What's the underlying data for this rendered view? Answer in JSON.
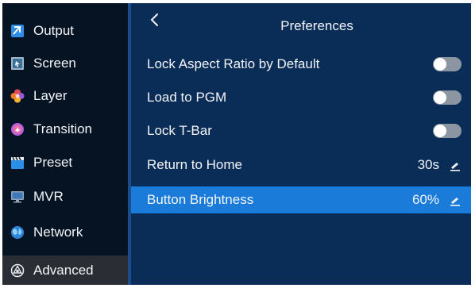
{
  "sidebar": {
    "items": [
      {
        "label": "Output",
        "icon": "output-icon"
      },
      {
        "label": "Screen",
        "icon": "screen-icon"
      },
      {
        "label": "Layer",
        "icon": "layer-icon"
      },
      {
        "label": "Transition",
        "icon": "transition-icon"
      },
      {
        "label": "Preset",
        "icon": "preset-icon"
      },
      {
        "label": "MVR",
        "icon": "mvr-icon"
      },
      {
        "label": "Network",
        "icon": "network-icon"
      },
      {
        "label": "Advanced",
        "icon": "advanced-icon"
      }
    ],
    "active_item": "Advanced"
  },
  "header": {
    "title": "Preferences",
    "back_icon": "chevron-left-icon"
  },
  "settings": [
    {
      "label": "Lock Aspect Ratio by Default",
      "type": "toggle",
      "on": false
    },
    {
      "label": "Load to PGM",
      "type": "toggle",
      "on": false
    },
    {
      "label": "Lock T-Bar",
      "type": "toggle",
      "on": false
    },
    {
      "label": "Return to Home",
      "type": "value",
      "value": "30s",
      "icon": "edit-icon"
    },
    {
      "label": "Button Brightness",
      "type": "value",
      "value": "60%",
      "icon": "edit-icon",
      "selected": true
    }
  ],
  "colors": {
    "background": "#061322",
    "panel": "#0a2d57",
    "selected_row": "#1a7bd8",
    "active_sidebar": "#2a2d33",
    "toggle_off": "#8c96a2"
  }
}
